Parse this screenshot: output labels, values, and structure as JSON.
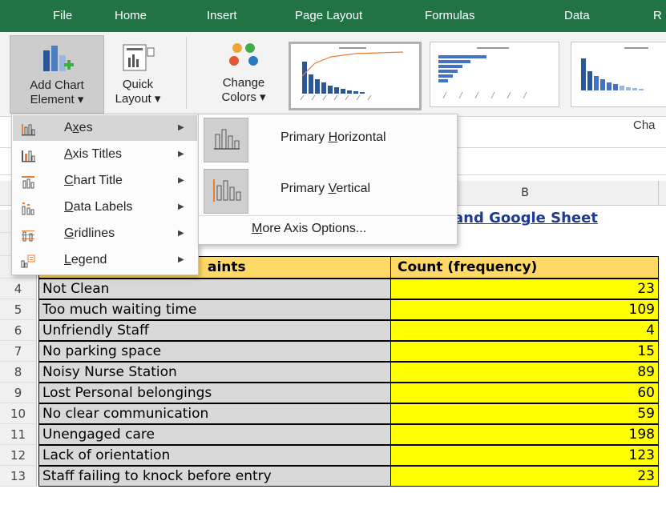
{
  "ribbon_tabs": [
    "File",
    "Home",
    "Insert",
    "Page Layout",
    "Formulas",
    "Data",
    "R"
  ],
  "ribbon": {
    "add_chart_element": {
      "line1": "Add Chart",
      "line2": "Element ▾"
    },
    "quick_layout": {
      "line1": "Quick",
      "line2": "Layout ▾"
    },
    "change_colors": {
      "line1": "Change",
      "line2": "Colors ▾"
    },
    "chart_styles_group_label": "Cha"
  },
  "add_chart_element_menu": [
    {
      "icon": "axes-icon",
      "label": "Axes",
      "underline": "x",
      "pre": "A",
      "post": "es"
    },
    {
      "icon": "axis-titles-icon",
      "label": "Axis Titles",
      "pre": "",
      "underline": "A",
      "post": "xis Titles"
    },
    {
      "icon": "chart-title-icon",
      "label": "Chart Title",
      "pre": "",
      "underline": "C",
      "post": "hart Title"
    },
    {
      "icon": "data-labels-icon",
      "label": "Data Labels",
      "pre": "",
      "underline": "D",
      "post": "ata Labels"
    },
    {
      "icon": "gridlines-icon",
      "label": "Gridlines",
      "pre": "",
      "underline": "G",
      "post": "ridlines"
    },
    {
      "icon": "legend-icon",
      "label": "Legend",
      "pre": "",
      "underline": "L",
      "post": "egend"
    }
  ],
  "axes_submenu": {
    "primary_horizontal": {
      "pre": "Primary ",
      "underline": "H",
      "post": "orizontal"
    },
    "primary_vertical": {
      "pre": "Primary ",
      "underline": "V",
      "post": "ertical"
    },
    "more_options": {
      "pre": "",
      "underline": "M",
      "post": "ore Axis Options..."
    }
  },
  "sheet": {
    "column_b_header": "B",
    "title_fragment": "and Google Sheet",
    "header_row": {
      "row": "",
      "a_fragment": "aints",
      "b": "Count (frequency)"
    },
    "rows": [
      {
        "row": "4",
        "complaint": "Not Clean",
        "count": "23"
      },
      {
        "row": "5",
        "complaint": "Too much waiting time",
        "count": "109"
      },
      {
        "row": "6",
        "complaint": "Unfriendly Staff",
        "count": "4"
      },
      {
        "row": "7",
        "complaint": "No parking space",
        "count": "15"
      },
      {
        "row": "8",
        "complaint": "Noisy Nurse Station",
        "count": "89"
      },
      {
        "row": "9",
        "complaint": "Lost Personal belongings",
        "count": "60"
      },
      {
        "row": "10",
        "complaint": "No clear communication",
        "count": "59"
      },
      {
        "row": "11",
        "complaint": "Unengaged care",
        "count": "198"
      },
      {
        "row": "12",
        "complaint": "Lack of orientation",
        "count": "123"
      },
      {
        "row": "13",
        "complaint": "Staff failing to knock before entry",
        "count": "23"
      }
    ]
  },
  "colors": {
    "ribbon_green": "#217346",
    "highlight_yellow": "#ffff00",
    "title_link_blue": "#1f3b8f",
    "header_orange": "#ffd966"
  }
}
